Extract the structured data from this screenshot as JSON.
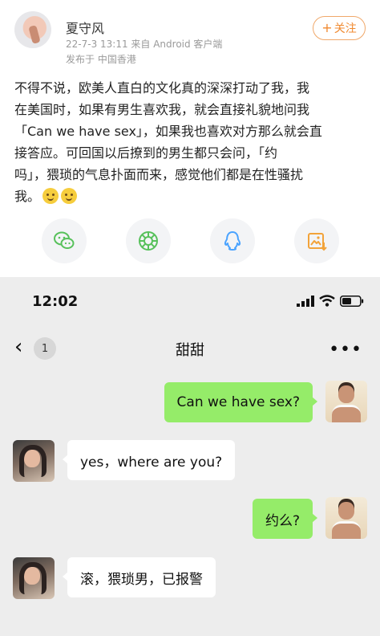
{
  "post": {
    "username": "夏守风",
    "meta": "22-7-3 13:11  来自 Android 客户端",
    "location": "发布于 中国香港",
    "follow_label": "关注",
    "content": "不得不说，欧美人直白的文化真的深深打动了我，我\n在美国时，如果有男生喜欢我，就会直接礼貌地问我\n「Can we have sex」，如果我也喜欢对方那么就会直\n接答应。可回国以后撩到的男生都只会问，「约\n吗」，猥琐的气息扑面而来，感觉他们都是在性骚扰\n我。",
    "emojis": [
      "smile-emoji",
      "smile-emoji"
    ],
    "share_icons": [
      "wechat-icon",
      "moments-icon",
      "qq-icon",
      "save-image-icon"
    ],
    "colors": {
      "follow": "#f08a30",
      "wechat": "#57c15b",
      "moments": "#57c15b",
      "qq": "#4aa3ff",
      "save": "#f2a33a"
    }
  },
  "chat": {
    "time": "12:02",
    "unread_count": "1",
    "title": "甜甜",
    "more": "•••",
    "back": "‹",
    "messages": [
      {
        "from": "me",
        "text": "Can we have sex?"
      },
      {
        "from": "her",
        "text": "yes，where are you?"
      },
      {
        "from": "me",
        "text": "约么?"
      },
      {
        "from": "her",
        "text": "滚，猥琐男，已报警"
      }
    ],
    "colors": {
      "background": "#ededed",
      "my_bubble": "#95ec69",
      "their_bubble": "#ffffff"
    }
  }
}
